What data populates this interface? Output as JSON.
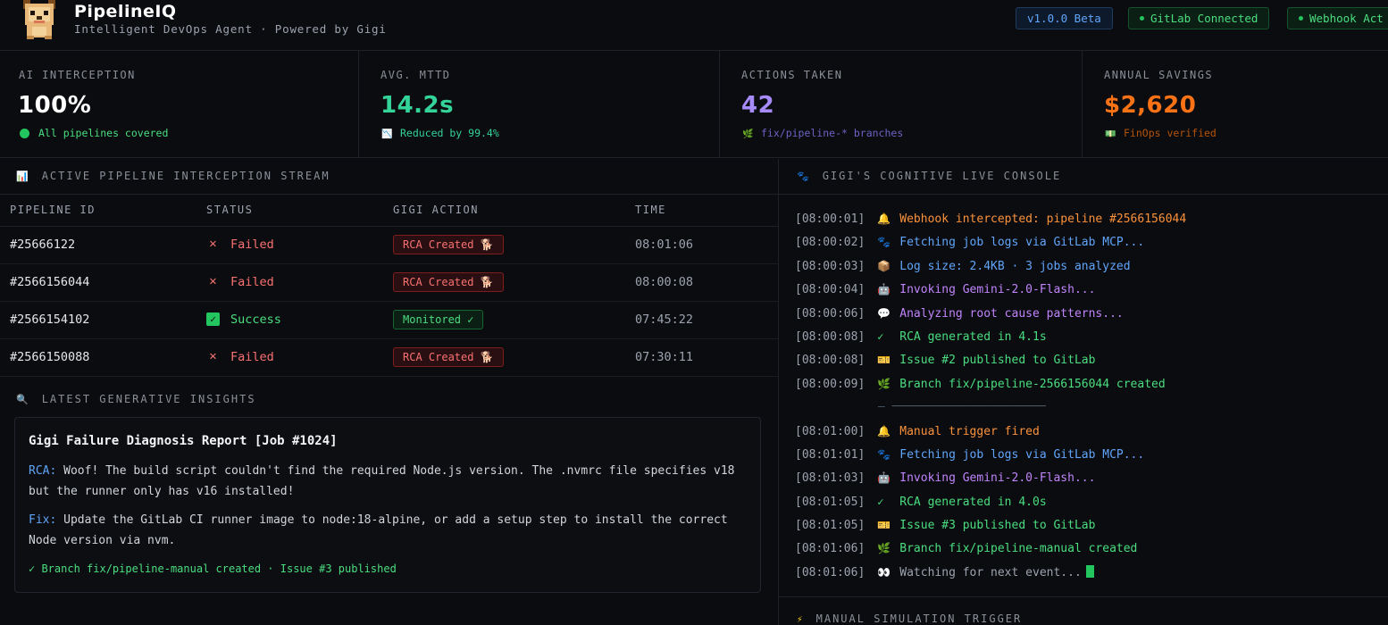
{
  "header": {
    "brand": "PipelineIQ",
    "tagline": "Intelligent DevOps Agent · Powered by Gigi",
    "badges": {
      "version": "v1.0.0 Beta",
      "gitlab": "GitLab Connected",
      "webhook": "Webhook Act"
    }
  },
  "stats": [
    {
      "label": "AI INTERCEPTION",
      "value": "100%",
      "sub": "All pipelines covered",
      "icon": "green-dot",
      "color": "#ffffff",
      "sub_color": "#4ade80"
    },
    {
      "label": "AVG. MTTD",
      "value": "14.2s",
      "sub": "Reduced by 99.4%",
      "icon": "trend-down-icon",
      "color": "#34d399",
      "sub_color": "#34d399"
    },
    {
      "label": "ACTIONS TAKEN",
      "value": "42",
      "sub": "fix/pipeline-* branches",
      "icon": "branch-icon",
      "color": "#a78bfa",
      "sub_color": "#7c6fd0"
    },
    {
      "label": "ANNUAL SAVINGS",
      "value": "$2,620",
      "sub": "FinOps verified",
      "icon": "money-icon",
      "color": "#f97316",
      "sub_color": "#d97706"
    }
  ],
  "stream": {
    "title": "ACTIVE PIPELINE INTERCEPTION STREAM",
    "columns": [
      "PIPELINE ID",
      "STATUS",
      "GIGI ACTION",
      "TIME"
    ],
    "rows": [
      {
        "id": "#25666122",
        "status": "Failed",
        "action": "RCA Created 🐕",
        "time": "08:01:06"
      },
      {
        "id": "#2566156044",
        "status": "Failed",
        "action": "RCA Created 🐕",
        "time": "08:00:08"
      },
      {
        "id": "#2566154102",
        "status": "Success",
        "action": "Monitored ✓",
        "time": "07:45:22"
      },
      {
        "id": "#2566150088",
        "status": "Failed",
        "action": "RCA Created 🐕",
        "time": "07:30:11"
      }
    ]
  },
  "insights": {
    "title": "LATEST GENERATIVE INSIGHTS",
    "report_title": "Gigi Failure Diagnosis Report [Job #1024]",
    "rca_label": "RCA:",
    "rca_text": "Woof! The build script couldn't find the required Node.js version. The .nvmrc file specifies v18 but the runner only has v16 installed!",
    "fix_label": "Fix:",
    "fix_text": "Update the GitLab CI runner image to node:18-alpine, or add a setup step to install the correct Node version via nvm.",
    "footer": "✓ Branch fix/pipeline-manual created · Issue #3 published"
  },
  "console": {
    "title": "GIGI'S COGNITIVE LIVE CONSOLE",
    "lines": [
      {
        "ts": "[08:00:01]",
        "icon": "🔔",
        "text": "Webhook intercepted: pipeline #2566156044",
        "color": "#fb923c"
      },
      {
        "ts": "[08:00:02]",
        "icon": "🐾",
        "text": "Fetching job logs via GitLab MCP...",
        "color": "#60a5fa"
      },
      {
        "ts": "[08:00:03]",
        "icon": "📦",
        "text": "Log size: 2.4KB · 3 jobs analyzed",
        "color": "#60a5fa"
      },
      {
        "ts": "[08:00:04]",
        "icon": "🤖",
        "text": "Invoking Gemini-2.0-Flash...",
        "color": "#c084fc"
      },
      {
        "ts": "[08:00:06]",
        "icon": "💬",
        "text": "Analyzing root cause patterns...",
        "color": "#c084fc"
      },
      {
        "ts": "[08:00:08]",
        "icon": "✓",
        "text": "RCA generated in 4.1s",
        "color": "#4ade80"
      },
      {
        "ts": "[08:00:08]",
        "icon": "🎫",
        "text": "Issue #2 published to GitLab",
        "color": "#4ade80"
      },
      {
        "ts": "[08:00:09]",
        "icon": "🌿",
        "text": "Branch fix/pipeline-2566156044 created",
        "color": "#4ade80"
      },
      {
        "separator": "— ──────────────────────"
      },
      {
        "ts": "[08:01:00]",
        "icon": "🔔",
        "text": "Manual trigger fired",
        "color": "#fb923c"
      },
      {
        "ts": "[08:01:01]",
        "icon": "🐾",
        "text": "Fetching job logs via GitLab MCP...",
        "color": "#60a5fa"
      },
      {
        "ts": "[08:01:03]",
        "icon": "🤖",
        "text": "Invoking Gemini-2.0-Flash...",
        "color": "#c084fc"
      },
      {
        "ts": "[08:01:05]",
        "icon": "✓",
        "text": "RCA generated in 4.0s",
        "color": "#4ade80"
      },
      {
        "ts": "[08:01:05]",
        "icon": "🎫",
        "text": "Issue #3 published to GitLab",
        "color": "#4ade80"
      },
      {
        "ts": "[08:01:06]",
        "icon": "🌿",
        "text": "Branch fix/pipeline-manual created",
        "color": "#4ade80"
      },
      {
        "ts": "[08:01:06]",
        "icon": "👀",
        "text": "Watching for next event...",
        "color": "#9ca3af",
        "cursor": true
      }
    ]
  },
  "manual": {
    "title": "MANUAL SIMULATION TRIGGER"
  }
}
